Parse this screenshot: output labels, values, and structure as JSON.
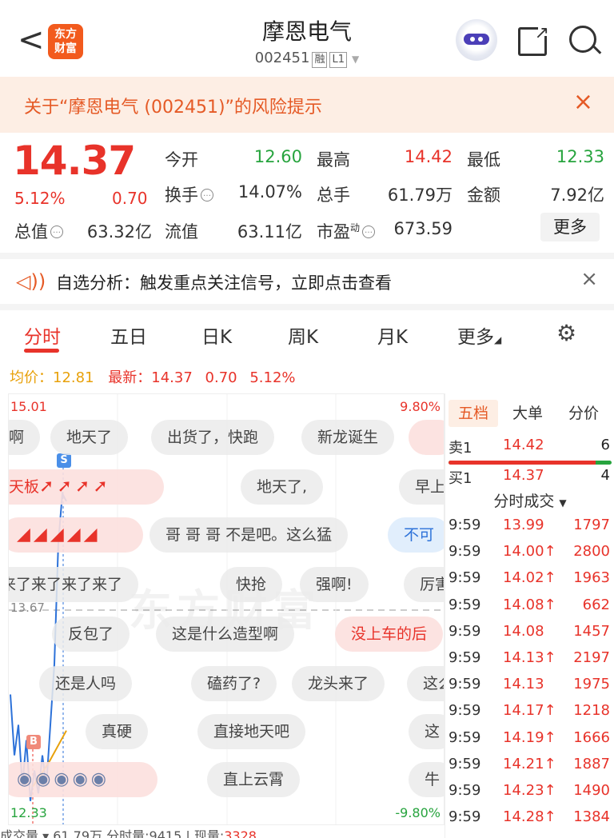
{
  "header": {
    "back": "<",
    "logo": "东方财富",
    "stock_name": "摩恩电气",
    "stock_code": "002451",
    "tag_rong": "融",
    "tag_level": "L1"
  },
  "risk_banner": {
    "text": "关于“摩恩电气 (002451)”的风险提示",
    "close": "×"
  },
  "quote": {
    "price": "14.37",
    "change_pct": "5.12%",
    "change": "0.70",
    "rows": [
      [
        {
          "label": "今开",
          "value": "12.60",
          "color": "green"
        },
        {
          "label": "最高",
          "value": "14.42",
          "color": "red"
        },
        {
          "label": "最低",
          "value": "12.33",
          "color": "green"
        }
      ],
      [
        {
          "label": "换手",
          "value": "14.07%",
          "color": "none"
        },
        {
          "label": "总手",
          "value": "61.79万",
          "color": "none"
        },
        {
          "label": "金额",
          "value": "7.92亿",
          "color": "none"
        }
      ]
    ],
    "total_value_label": "总值",
    "total_value": "63.32亿",
    "float_label": "流值",
    "float_value": "63.11亿",
    "pe_label": "市盈",
    "pe_sup": "动",
    "pe_value": "673.59",
    "more_label": "更多"
  },
  "analysis": {
    "text": "自选分析：触发重点关注信号，立即点击查看",
    "close": "×"
  },
  "tabs": [
    "分时",
    "五日",
    "日K",
    "周K",
    "月K",
    "更多"
  ],
  "chart_info": {
    "avg_label": "均价：",
    "avg_value": "12.81",
    "latest_label": "最新：",
    "latest_value": "14.37",
    "latest_change": "0.70",
    "latest_pct": "5.12%"
  },
  "chart_data": {
    "type": "line",
    "y_top": "15.01",
    "y_top_pct": "9.80%",
    "y_mid": "13.67",
    "y_bottom": "12.33",
    "y_bottom_pct": "-9.80%",
    "ylim": [
      12.33,
      15.01
    ],
    "values": [
      13.1,
      12.7,
      12.9,
      12.5,
      12.8,
      12.4,
      12.6,
      12.45,
      12.7,
      12.5,
      12.9,
      13.3,
      14.1,
      14.42,
      14.37
    ]
  },
  "danmaku": [
    {
      "text": "啊",
      "style": "gray"
    },
    {
      "text": "地天了",
      "style": "gray"
    },
    {
      "text": "出货了，快跑",
      "style": "gray"
    },
    {
      "text": "新龙诞生",
      "style": "gray"
    },
    {
      "text": "天板",
      "style": "pink"
    },
    {
      "text": "地天了,",
      "style": "gray"
    },
    {
      "text": "早上",
      "style": "gray"
    },
    {
      "text": "哥 哥 哥 不是吧。这么猛",
      "style": "gray"
    },
    {
      "text": "不可",
      "style": "blue"
    },
    {
      "text": "来了来了来了来了",
      "style": "gray"
    },
    {
      "text": "快抢",
      "style": "gray"
    },
    {
      "text": "强啊!",
      "style": "gray"
    },
    {
      "text": "厉害",
      "style": "gray"
    },
    {
      "text": "反包了",
      "style": "gray"
    },
    {
      "text": "这是什么造型啊",
      "style": "gray"
    },
    {
      "text": "没上车的后",
      "style": "pink"
    },
    {
      "text": "还是人吗",
      "style": "gray"
    },
    {
      "text": "磕药了?",
      "style": "gray"
    },
    {
      "text": "龙头来了",
      "style": "gray"
    },
    {
      "text": "这么",
      "style": "gray"
    },
    {
      "text": "真硬",
      "style": "gray"
    },
    {
      "text": "直接地天吧",
      "style": "gray"
    },
    {
      "text": "这",
      "style": "gray"
    },
    {
      "text": "直上云霄",
      "style": "gray"
    },
    {
      "text": "牛",
      "style": "gray"
    }
  ],
  "markers": {
    "sell": "S",
    "buy": "B"
  },
  "order_book": {
    "tabs": [
      "五档",
      "大单",
      "分价"
    ],
    "sell1": {
      "label": "卖1",
      "price": "14.42",
      "vol": "6"
    },
    "buy1": {
      "label": "买1",
      "price": "14.37",
      "vol": "4"
    },
    "buy_ratio": 0.9,
    "ticks_title": "分时成交",
    "ticks": [
      {
        "time": "9:59",
        "price": "13.99",
        "vol": "1797"
      },
      {
        "time": "9:59",
        "price": "14.00↑",
        "vol": "2800"
      },
      {
        "time": "9:59",
        "price": "14.02↑",
        "vol": "1963"
      },
      {
        "time": "9:59",
        "price": "14.08↑",
        "vol": "662"
      },
      {
        "time": "9:59",
        "price": "14.08",
        "vol": "1457"
      },
      {
        "time": "9:59",
        "price": "14.13↑",
        "vol": "2197"
      },
      {
        "time": "9:59",
        "price": "14.13",
        "vol": "1975"
      },
      {
        "time": "9:59",
        "price": "14.17↑",
        "vol": "1218"
      },
      {
        "time": "9:59",
        "price": "14.19↑",
        "vol": "1666"
      },
      {
        "time": "9:59",
        "price": "14.21↑",
        "vol": "1887"
      },
      {
        "time": "9:59",
        "price": "14.23↑",
        "vol": "1490"
      },
      {
        "time": "9:59",
        "price": "14.28↑",
        "vol": "1384"
      }
    ]
  },
  "bottom": {
    "label": "成交量",
    "total": "61.79万",
    "min_label": "分时量:",
    "min_value": "9415",
    "now_label": "现量:",
    "now_value": "3328"
  },
  "colors": {
    "up": "#e8332a",
    "down": "#27a43e",
    "accent": "#e55a26",
    "avg_line": "#e8a10b",
    "price_line": "#2d72d9"
  }
}
